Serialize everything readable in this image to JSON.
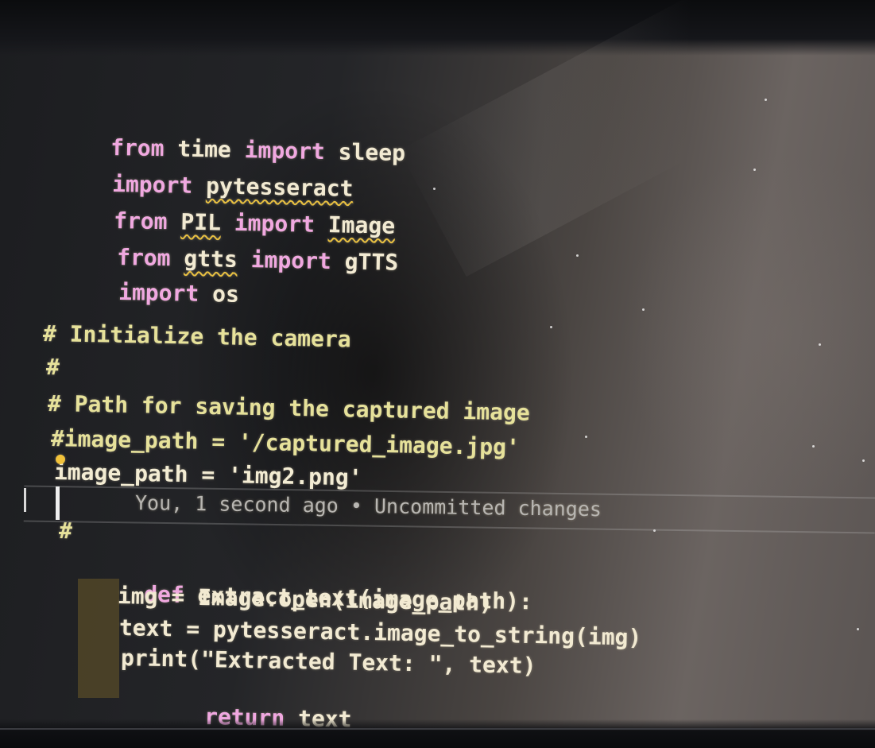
{
  "editor": {
    "lines": [
      {
        "kw1": "from",
        "mod": "time",
        "kw2": "import",
        "name": "sleep"
      },
      {
        "kw1": "import",
        "mod": "pytesseract"
      },
      {
        "kw1": "from",
        "mod": "PIL",
        "kw2": "import",
        "name": "Image"
      },
      {
        "kw1": "from",
        "mod": "gtts",
        "kw2": "import",
        "name": "gTTS"
      },
      {
        "kw1": "import",
        "mod": "os"
      }
    ],
    "comment_init": "# Initialize the camera",
    "comment_hash_1": "#",
    "comment_path": "# Path for saving the captured image",
    "comment_image_path": "#image_path = '/captured_image.jpg'",
    "image_path_line": "image_path = 'img2.png'",
    "blame": "You, 1 second ago • Uncommitted changes",
    "comment_hash_2": "#",
    "def_kw": "def",
    "def_sig": "extract_text(image_path):",
    "body": [
      "img = Image.open(image_path)",
      "text = pytesseract.image_to_string(img)",
      "print(\"Extracted Text: \", text)"
    ],
    "return_kw": "return",
    "return_val": "text"
  },
  "icons": {
    "lightbulb": "lightbulb-icon"
  },
  "colors": {
    "keyword": "#f0a8e0",
    "comment": "#e6e19a",
    "text": "#f2ead2",
    "squiggle": "#e8c040"
  }
}
